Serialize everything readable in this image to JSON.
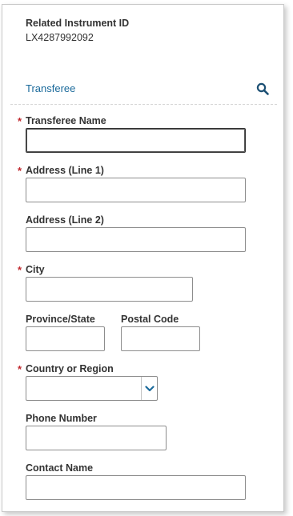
{
  "related": {
    "label": "Related Instrument ID",
    "value": "LX4287992092"
  },
  "section": {
    "title": "Transferee",
    "search_icon": "search-icon"
  },
  "required_marker": "*",
  "fields": {
    "transferee_name": {
      "label": "Transferee Name",
      "value": "",
      "required": true
    },
    "address_line1": {
      "label": "Address (Line 1)",
      "value": "",
      "required": true
    },
    "address_line2": {
      "label": "Address (Line 2)",
      "value": "",
      "required": false
    },
    "city": {
      "label": "City",
      "value": "",
      "required": true
    },
    "province_state": {
      "label": "Province/State",
      "value": "",
      "required": false
    },
    "postal_code": {
      "label": "Postal Code",
      "value": "",
      "required": false
    },
    "country_region": {
      "label": "Country or Region",
      "value": "",
      "required": true,
      "dropdown_icon": "chevron-down-icon"
    },
    "phone_number": {
      "label": "Phone Number",
      "value": "",
      "required": false
    },
    "contact_name": {
      "label": "Contact Name",
      "value": "",
      "required": false
    }
  },
  "colors": {
    "accent": "#1b6a9b",
    "required": "#c0272d"
  }
}
